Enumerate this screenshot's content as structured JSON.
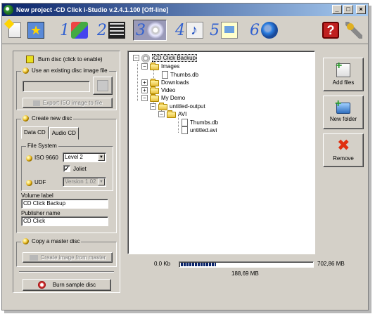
{
  "window": {
    "title": "New project -CD Click i-Studio v.2.4.1.100 [Off-line]",
    "controls": {
      "minimize": "_",
      "maximize": "□",
      "close": "×"
    }
  },
  "toolbar": {
    "steps": [
      {
        "num": "1",
        "icon": "palette-tools-icon"
      },
      {
        "num": "2",
        "icon": "film-icon"
      },
      {
        "num": "3",
        "icon": "disc-icon",
        "active": true
      },
      {
        "num": "4",
        "icon": "music-icon"
      },
      {
        "num": "5",
        "icon": "document-icon"
      },
      {
        "num": "6",
        "icon": "globe-icon"
      }
    ],
    "help_icon": "?"
  },
  "left": {
    "burn_disc": "Burn disc (click to enable)",
    "use_existing": {
      "legend": "Use an existing disc image file",
      "path_value": "",
      "export_button": "Export ISO image to file"
    },
    "create_new": {
      "legend": "Create new disc",
      "tabs": [
        "Data CD",
        "Audio CD"
      ],
      "file_system": {
        "legend": "File System",
        "iso_label": "ISO 9660",
        "iso_level": "Level 2",
        "joliet_label": "Joliet",
        "joliet_checked": "✓",
        "udf_label": "UDF",
        "udf_version": "Version 1.02"
      },
      "volume_label": "Volume label",
      "volume_value": "CD Click Backup",
      "publisher_label": "Publisher name",
      "publisher_value": "CD Click"
    },
    "copy_master": {
      "legend": "Copy a master disc",
      "create_image_button": "Create image from master"
    },
    "burn_sample": "Burn sample disc"
  },
  "tree": {
    "root": "CD Click Backup",
    "expander_minus": "−",
    "expander_plus": "+",
    "nodes": {
      "images": "Images",
      "images_thumbs": "Thumbs.db",
      "downloads": "Downloads",
      "video": "Video",
      "my_demo": "My Demo",
      "untitled_output": "untitled-output",
      "avi": "AVI",
      "avi_thumbs": "Thumbs.db",
      "untitled_avi": "untitled.avi"
    }
  },
  "actions": {
    "add_files": "Add files",
    "new_folder": "New folder",
    "remove": "Remove"
  },
  "capacity": {
    "min": "0.0 Kb",
    "used": "188,69 MB",
    "max": "702,86 MB",
    "fill_fraction": 0.27
  }
}
